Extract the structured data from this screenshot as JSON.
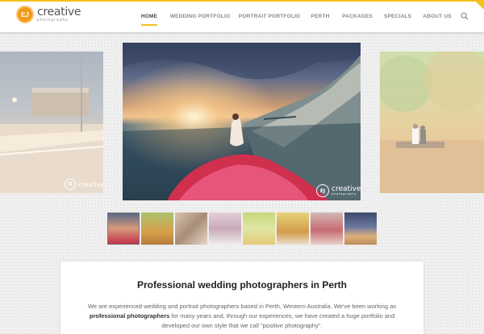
{
  "logo": {
    "mark_text": "EJ",
    "name": "creative",
    "tagline": "photography"
  },
  "nav": {
    "items": [
      {
        "label": "HOME",
        "active": true
      },
      {
        "label": "WEDDING PORTFOLIO",
        "active": false
      },
      {
        "label": "PORTRAIT PORTFOLIO",
        "active": false
      },
      {
        "label": "PERTH",
        "active": false
      },
      {
        "label": "PACKAGES",
        "active": false
      },
      {
        "label": "SPECIALS",
        "active": false
      },
      {
        "label": "ABOUT US",
        "active": false
      }
    ],
    "search_icon": "search-icon"
  },
  "slider": {
    "watermark": {
      "mark": "EJ",
      "name": "creative",
      "sub": "photography"
    },
    "thumbnail_count": 8
  },
  "content": {
    "title": "Professional wedding photographers in Perth",
    "line1": "We are experienced wedding and portrait photographers based in Perth, Western Australia. We've been working as",
    "line2_bold": "professional photographers",
    "line2_rest": " for many years and, through our experiences, we have created a huge portfolio and",
    "line3": "developed our own style that we call \"positive photography\"."
  },
  "colors": {
    "accent": "#f2c21b",
    "logo_orange": "#f29a1a"
  }
}
